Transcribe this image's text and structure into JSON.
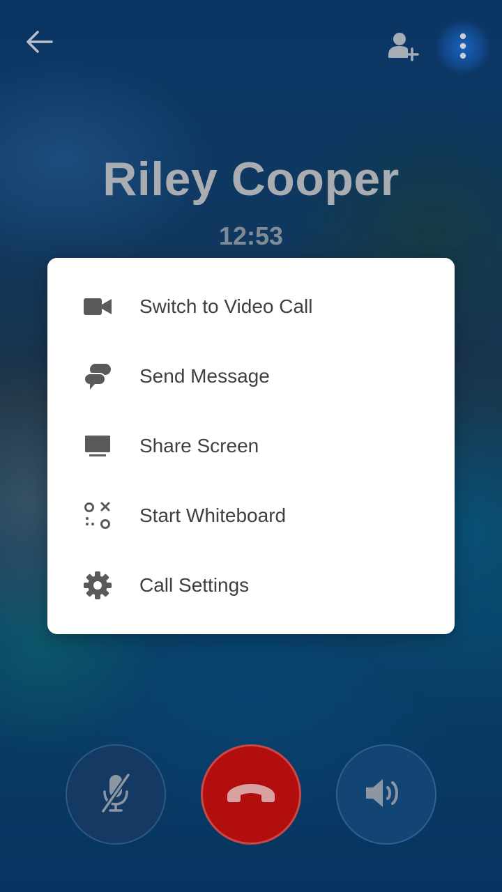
{
  "call": {
    "caller_name": "Riley Cooper",
    "duration": "12:53"
  },
  "header": {
    "back_icon": "arrow-left-icon",
    "add_participant_icon": "person-add-icon",
    "more_icon": "more-vertical-icon"
  },
  "menu": {
    "items": [
      {
        "label": "Switch to Video Call",
        "icon": "videocam-icon"
      },
      {
        "label": "Send Message",
        "icon": "chat-bubbles-icon"
      },
      {
        "label": "Share Screen",
        "icon": "monitor-icon"
      },
      {
        "label": "Start Whiteboard",
        "icon": "whiteboard-icon"
      },
      {
        "label": "Call Settings",
        "icon": "gear-icon"
      }
    ]
  },
  "controls": {
    "mute_icon": "mic-off-icon",
    "end_call_icon": "hang-up-icon",
    "speaker_icon": "speaker-icon"
  },
  "colors": {
    "end_call": "#b30e0e",
    "menu_background": "#ffffff",
    "menu_text": "#3f3f3f",
    "menu_icon": "#5a5a5a"
  }
}
